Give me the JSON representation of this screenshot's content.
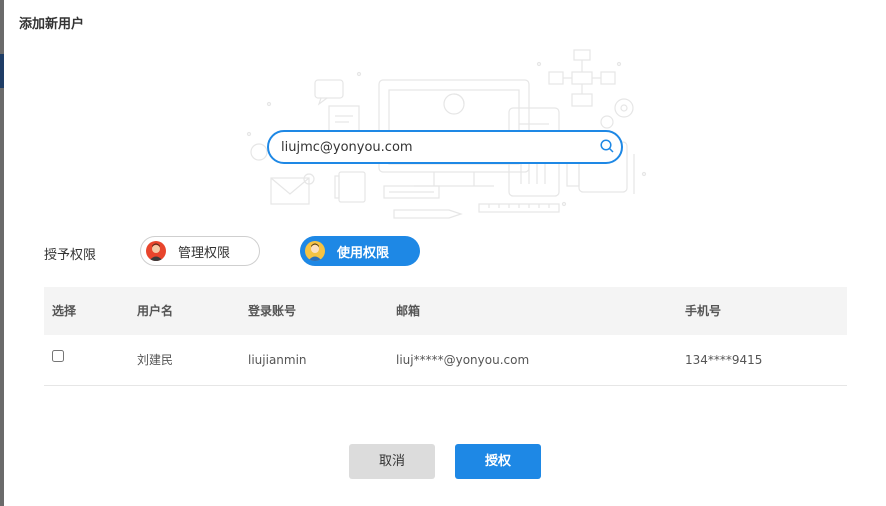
{
  "dialog": {
    "title": "添加新用户"
  },
  "search": {
    "value": "liujmc@yonyou.com"
  },
  "permissions": {
    "label": "授予权限",
    "options": [
      {
        "label": "管理权限",
        "selected": false
      },
      {
        "label": "使用权限",
        "selected": true
      }
    ]
  },
  "table": {
    "headers": [
      "选择",
      "用户名",
      "登录账号",
      "邮箱",
      "手机号"
    ],
    "rows": [
      {
        "checked": false,
        "username": "刘建民",
        "account": "liujianmin",
        "email": "liuj*****@yonyou.com",
        "phone": "134****9415"
      }
    ]
  },
  "buttons": {
    "cancel": "取消",
    "authorize": "授权"
  },
  "colors": {
    "accent": "#1e88e5",
    "cancel_bg": "#dcdcdc",
    "header_bg": "#f4f4f4"
  }
}
